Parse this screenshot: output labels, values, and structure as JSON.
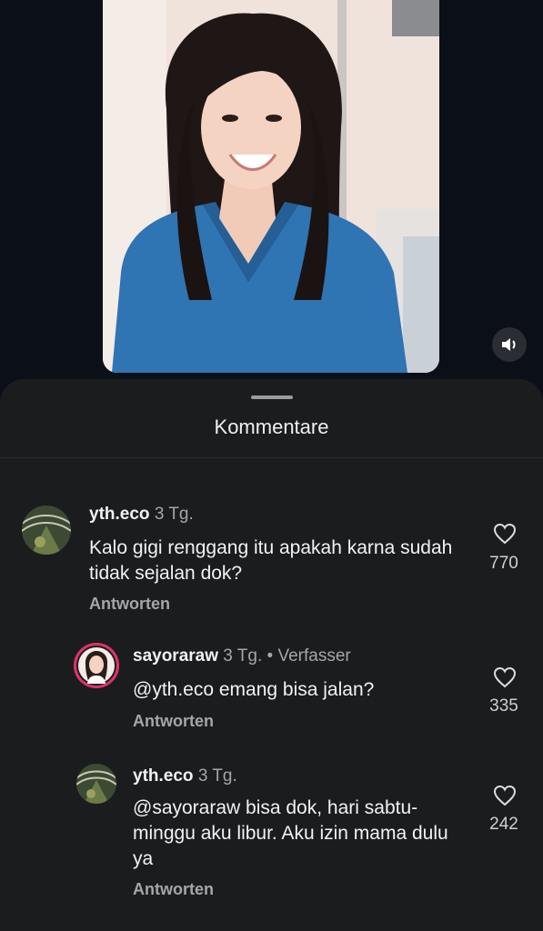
{
  "sheet": {
    "title": "Kommentare"
  },
  "comments": [
    {
      "username": "yth.eco",
      "age": "3 Tg.",
      "badge": "",
      "text": "Kalo gigi renggang itu apakah karna sudah tidak sejalan dok?",
      "reply_label": "Antworten",
      "likes": "770"
    },
    {
      "username": "sayoraraw",
      "age": "3 Tg.",
      "badge": "• Verfasser",
      "text": "@yth.eco emang bisa jalan?",
      "reply_label": "Antworten",
      "likes": "335"
    },
    {
      "username": "yth.eco",
      "age": "3 Tg.",
      "badge": "",
      "text": "@sayoraraw bisa dok, hari sabtu-minggu aku libur. Aku izin mama dulu ya",
      "reply_label": "Antworten",
      "likes": "242"
    }
  ],
  "icons": {
    "sound": "speaker-icon",
    "like": "heart-outline-icon"
  },
  "colors": {
    "background": "#0b1018",
    "sheet": "#1b1c1e",
    "scrubs": "#2f74b3",
    "story_ring": "#e1306c"
  }
}
